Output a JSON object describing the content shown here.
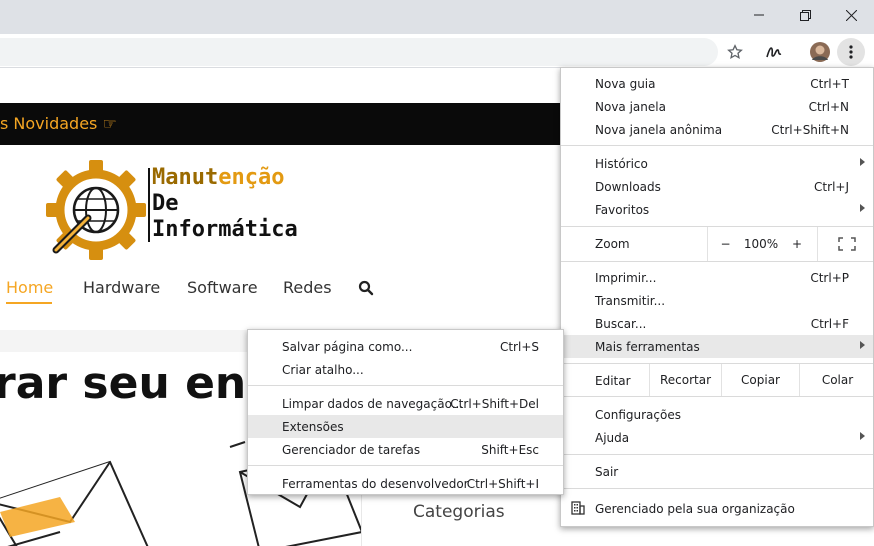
{
  "window": {
    "minimize_icon": "minimize-icon",
    "maximize_icon": "restore-icon",
    "close_icon": "close-icon"
  },
  "toolbar": {
    "bookmark_icon": "star-icon",
    "extension_icon": "signature-icon",
    "menu_icon": "kebab-menu-icon"
  },
  "site": {
    "top_bar_text": "s Novidades",
    "logo_line1_a": "Manut",
    "logo_line1_b": "enção",
    "logo_line2": "De",
    "logo_line3": "Informática",
    "nav": [
      "Home",
      "Hardware",
      "Software",
      "Redes"
    ],
    "hero_title": "rar seu en",
    "sidebar_heading": "Categorias",
    "accent": "#f5a623"
  },
  "menu": {
    "new_tab": {
      "label": "Nova guia",
      "shortcut": "Ctrl+T"
    },
    "new_window": {
      "label": "Nova janela",
      "shortcut": "Ctrl+N"
    },
    "incognito": {
      "label": "Nova janela anônima",
      "shortcut": "Ctrl+Shift+N"
    },
    "history": {
      "label": "Histórico"
    },
    "downloads": {
      "label": "Downloads",
      "shortcut": "Ctrl+J"
    },
    "bookmarks": {
      "label": "Favoritos"
    },
    "zoom": {
      "label": "Zoom",
      "minus": "−",
      "value": "100%",
      "plus": "+"
    },
    "print": {
      "label": "Imprimir...",
      "shortcut": "Ctrl+P"
    },
    "cast": {
      "label": "Transmitir..."
    },
    "find": {
      "label": "Buscar...",
      "shortcut": "Ctrl+F"
    },
    "more_tools": {
      "label": "Mais ferramentas"
    },
    "edit": {
      "label": "Editar",
      "cut": "Recortar",
      "copy": "Copiar",
      "paste": "Colar"
    },
    "settings": {
      "label": "Configurações"
    },
    "help": {
      "label": "Ajuda"
    },
    "exit": {
      "label": "Sair"
    },
    "managed": {
      "label": "Gerenciado pela sua organização"
    }
  },
  "submenu": {
    "save_page": {
      "label": "Salvar página como...",
      "shortcut": "Ctrl+S"
    },
    "create_shortcut": {
      "label": "Criar atalho..."
    },
    "clear_data": {
      "label": "Limpar dados de navegação...",
      "shortcut": "Ctrl+Shift+Del"
    },
    "extensions": {
      "label": "Extensões"
    },
    "task_manager": {
      "label": "Gerenciador de tarefas",
      "shortcut": "Shift+Esc"
    },
    "dev_tools": {
      "label": "Ferramentas do desenvolvedor",
      "shortcut": "Ctrl+Shift+I"
    }
  }
}
